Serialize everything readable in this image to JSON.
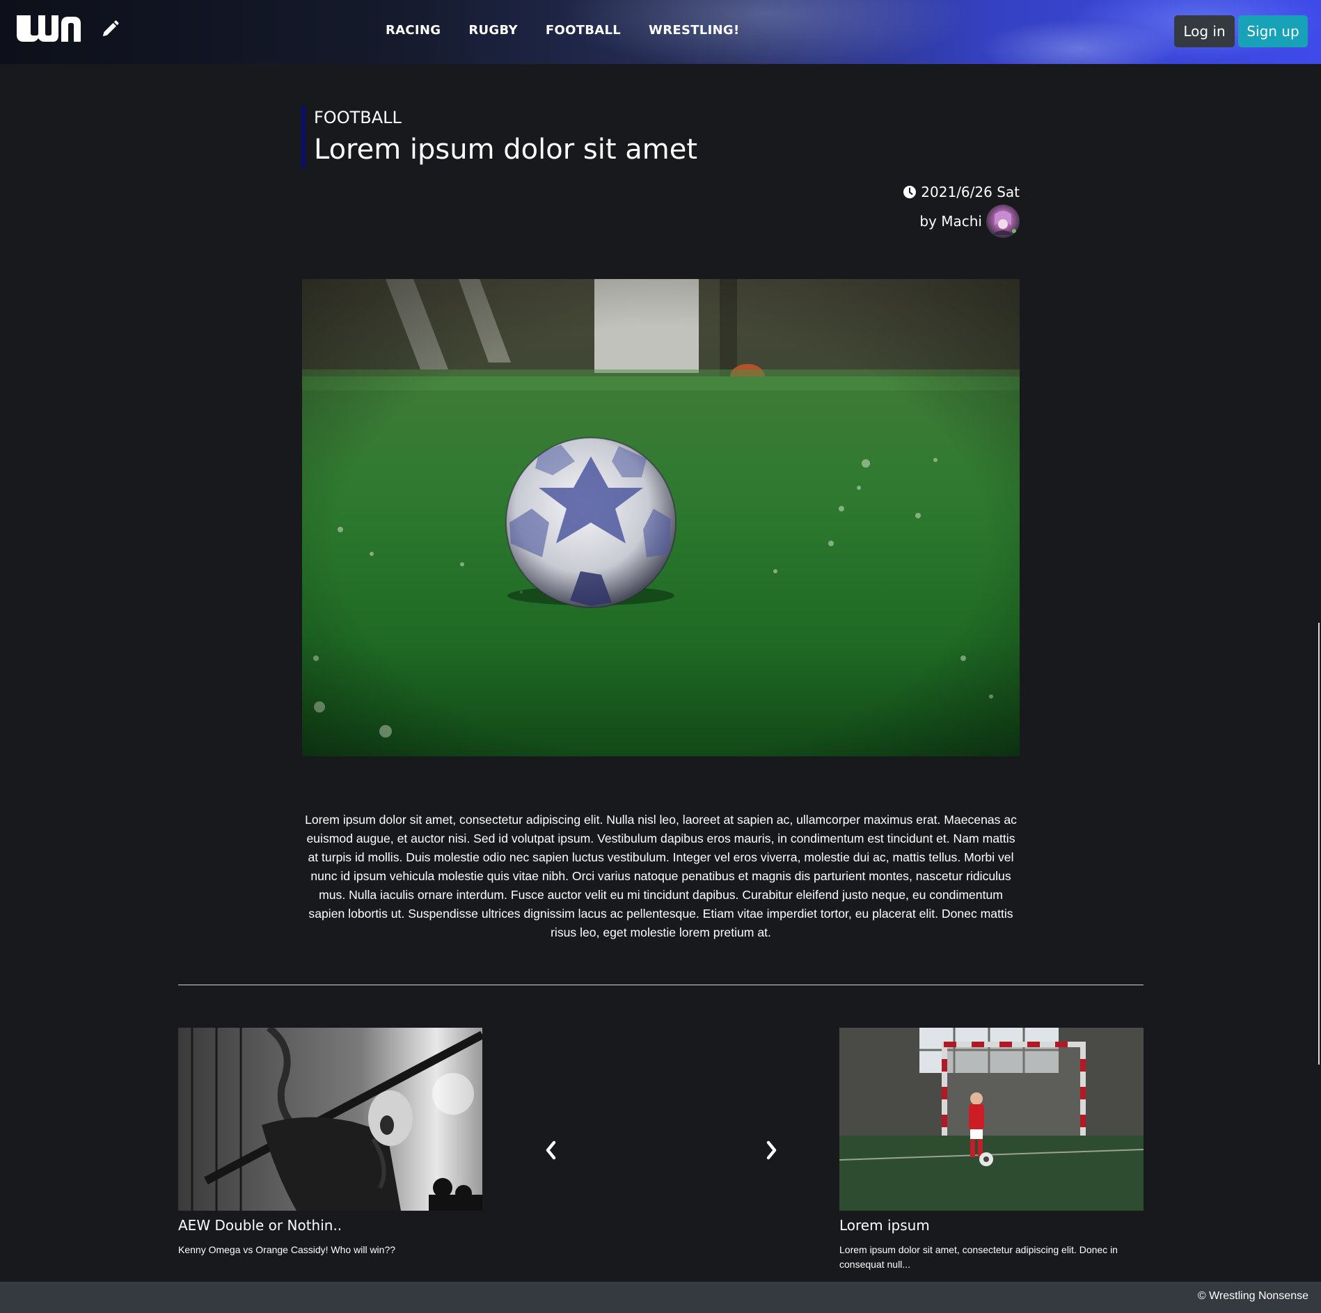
{
  "header": {
    "logo_text": "wn",
    "nav_links": [
      "RACING",
      "RUGBY",
      "FOOTBALL",
      "WRESTLING!"
    ],
    "login_label": "Log in",
    "signup_label": "Sign up"
  },
  "article": {
    "category": "FOOTBALL",
    "title": "Lorem ipsum dolor sit amet",
    "date": "2021/6/26 Sat",
    "author": "by Machi",
    "body": "Lorem ipsum dolor sit amet, consectetur adipiscing elit. Nulla nisl leo, laoreet at sapien ac, ullamcorper maximus erat. Maecenas ac euismod augue, et auctor nisi. Sed id volutpat ipsum. Vestibulum dapibus eros mauris, in condimentum est tincidunt et. Nam mattis at turpis id mollis. Duis molestie odio nec sapien luctus vestibulum. Integer vel eros viverra, molestie dui ac, mattis tellus. Morbi vel nunc id ipsum vehicula molestie quis vitae nibh. Orci varius natoque penatibus et magnis dis parturient montes, nascetur ridiculus mus. Nulla iaculis ornare interdum. Fusce auctor velit eu mi tincidunt dapibus. Curabitur eleifend justo neque, eu condimentum sapien lobortis ut. Suspendisse ultrices dignissim lacus ac pellentesque. Etiam vitae imperdiet tortor, eu placerat elit. Donec mattis risus leo, eget molestie lorem pretium at."
  },
  "carousel": {
    "items": [
      {
        "title": "AEW Double or Nothin..",
        "text": "Kenny Omega vs Orange Cassidy! Who will win??"
      },
      {
        "title": "Lorem ipsum",
        "text": "Lorem ipsum dolor sit amet, consectetur adipiscing elit. Donec in consequat null..."
      }
    ]
  },
  "footer": {
    "copyright": "© Wrestling Nonsense"
  },
  "colors": {
    "background": "#18191c",
    "footer": "#343a40",
    "login_button": "#343a40",
    "signup_button": "#17a2b8",
    "title_accent": "#0b0f6b"
  }
}
